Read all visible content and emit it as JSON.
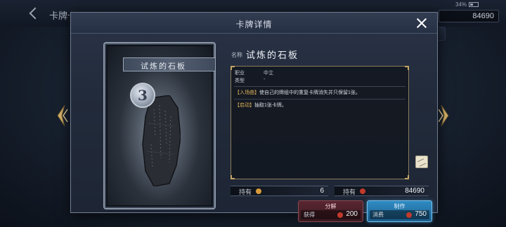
{
  "background": {
    "title": "卡牌卡",
    "battery": "34%",
    "currency_value": "84690"
  },
  "modal": {
    "title": "卡牌详情",
    "card": {
      "cost": "3",
      "name": "试炼的石板"
    },
    "name_label": "名称",
    "name_value": "试炼的石板",
    "details": {
      "class_label": "职业",
      "class_value": "中立",
      "type_label": "类型",
      "type_value": "-"
    },
    "effects": [
      {
        "keyword": "【入场曲】",
        "text": "使自己的牌组中的重复卡牌消失并只保留1张。"
      },
      {
        "keyword": "【启动】",
        "text": "抽取1张卡牌。"
      }
    ],
    "holdings": {
      "owned_label": "持有",
      "owned_count": "6",
      "vial_label": "持有",
      "vial_count": "84690"
    },
    "buttons": {
      "decompose": {
        "title": "分解",
        "sub_label": "获得",
        "amount": "200"
      },
      "craft": {
        "title": "制作",
        "sub_label": "消费",
        "amount": "750"
      }
    },
    "colors": {
      "keyword": "#e0b35a",
      "craft_button": "#2f8bc2",
      "decompose_button": "#5a2630",
      "vial_red": "#c0392b",
      "card_gold": "#d99a3a"
    }
  }
}
